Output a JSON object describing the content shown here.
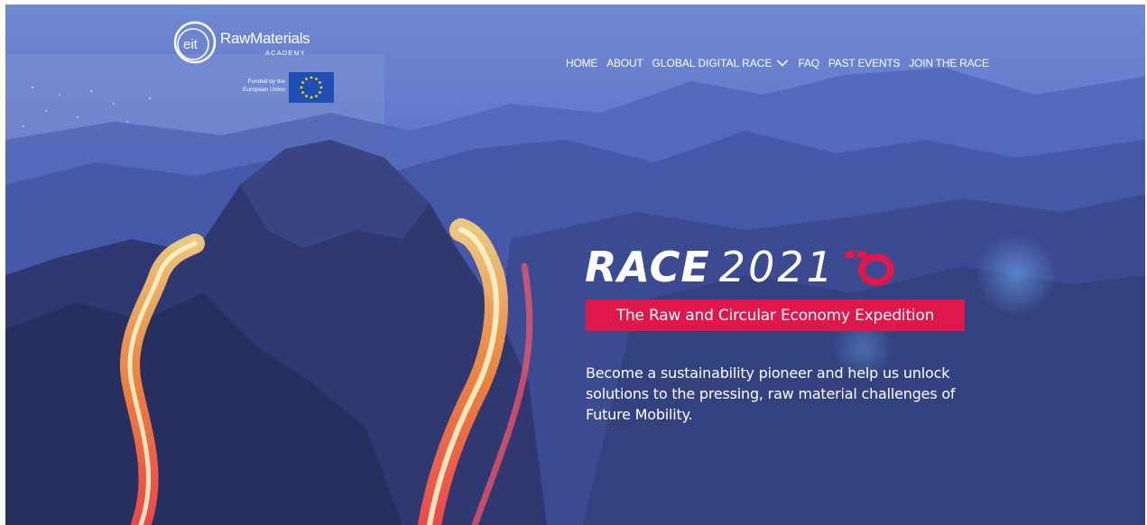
{
  "brand": {
    "eit_text": "eit",
    "name": "RawMaterials",
    "sub": "ACADEMY",
    "funded_line1": "Funded by the",
    "funded_line2": "European Union"
  },
  "nav": {
    "items": [
      "HOME",
      "ABOUT",
      "GLOBAL DIGITAL RACE",
      "FAQ",
      "PAST EVENTS",
      "JOIN THE RACE"
    ],
    "dropdown_icon": "chevron-down-icon"
  },
  "hero": {
    "title_bold": "RACE",
    "title_year": "2021",
    "subtitle": "The Raw and Circular Economy Expedition",
    "description": "Become a sustainability pioneer and help us unlock solutions to the pressing, raw material challenges of Future Mobility."
  },
  "colors": {
    "accent": "#e0174a",
    "sky": "#6f86cf",
    "mountain": "#2d3566",
    "light_trail": "#ffb347",
    "eu_blue": "#1f4fb5",
    "eu_star": "#ffd400"
  }
}
